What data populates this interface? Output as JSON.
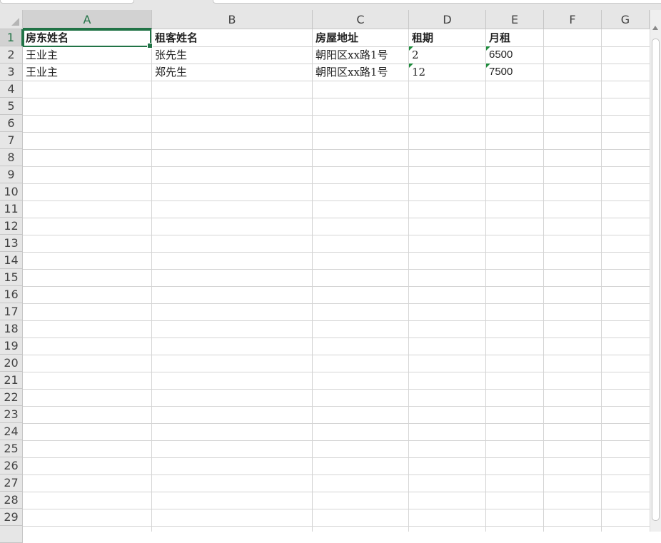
{
  "sheet": {
    "columns": [
      "A",
      "B",
      "C",
      "D",
      "E",
      "F",
      "G"
    ],
    "rows": [
      "1",
      "2",
      "3",
      "4",
      "5",
      "6",
      "7",
      "8",
      "9",
      "10",
      "11",
      "12",
      "13",
      "14",
      "15",
      "16",
      "17",
      "18",
      "19",
      "20",
      "21",
      "22",
      "23",
      "24",
      "25",
      "26",
      "27",
      "28",
      "29"
    ],
    "selected_cell": "A1",
    "cells": {
      "A1": "房东姓名",
      "B1": "租客姓名",
      "C1": "房屋地址",
      "D1": "租期",
      "E1": "月租",
      "A2": "王业主",
      "B2": "张先生",
      "C2": "朝阳区xx路1号",
      "D2": "2",
      "E2": "6500",
      "A3": "王业主",
      "B3": "郑先生",
      "C3": "朝阳区xx路1号",
      "D3": "12",
      "E3": "7500"
    }
  },
  "colors": {
    "accent": "#217346",
    "number_stored_as_text_flag": "#1e8a3c",
    "gridline": "#d4d4d4",
    "header_bg": "#e6e6e6"
  },
  "icons": {
    "select_all": "select-all-triangle-icon",
    "scroll_up": "scroll-up-arrow-icon"
  }
}
